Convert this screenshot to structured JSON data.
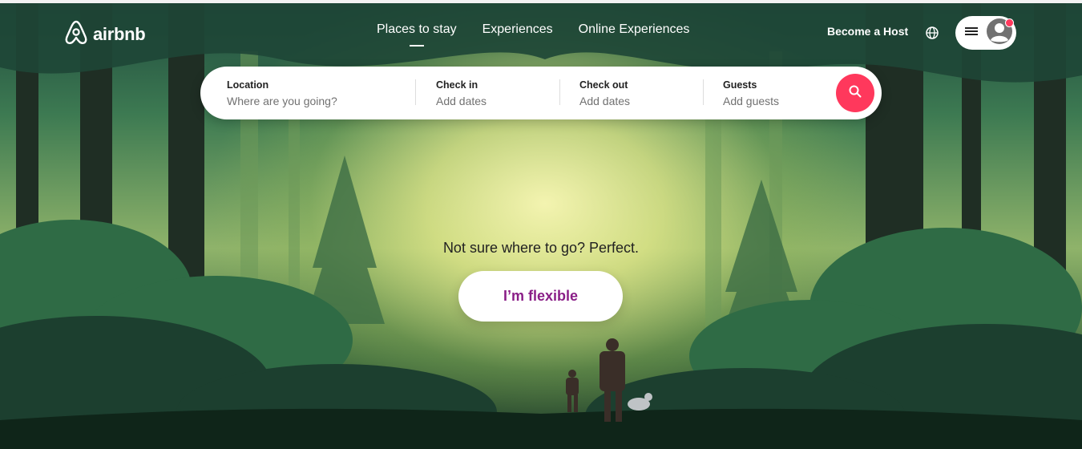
{
  "brand": {
    "name": "airbnb",
    "color": "#ff385c",
    "logo_icon": "airbnb-logo-icon"
  },
  "nav": {
    "items": [
      {
        "label": "Places to stay",
        "active": true
      },
      {
        "label": "Experiences",
        "active": false
      },
      {
        "label": "Online Experiences",
        "active": false
      }
    ]
  },
  "header": {
    "host_label": "Become a Host",
    "globe_icon": "globe-icon",
    "menu_icon": "hamburger-icon",
    "avatar_icon": "user-avatar-icon",
    "notification_dot_color": "#ff385c"
  },
  "search": {
    "location": {
      "label": "Location",
      "placeholder": "Where are you going?"
    },
    "checkin": {
      "label": "Check in",
      "placeholder": "Add dates"
    },
    "checkout": {
      "label": "Check out",
      "placeholder": "Add dates"
    },
    "guests": {
      "label": "Guests",
      "placeholder": "Add guests"
    },
    "button_icon": "search-icon",
    "button_color": "#ff385c"
  },
  "hero": {
    "prompt": "Not sure where to go? Perfect.",
    "flexible_label": "I’m flexible",
    "flexible_color": "#8a1e87"
  }
}
